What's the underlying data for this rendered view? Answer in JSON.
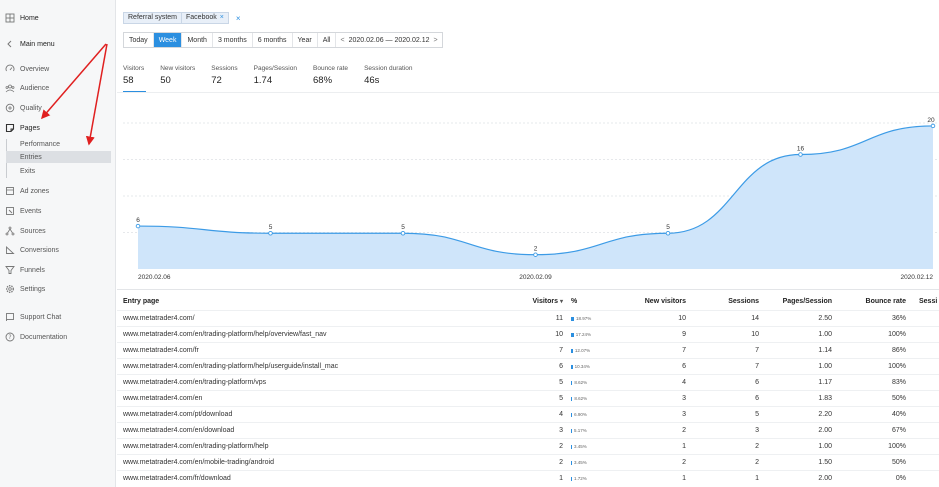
{
  "sidebar": {
    "items": [
      {
        "label": "Home",
        "icon": "home-icon"
      },
      {
        "label": "Main menu",
        "icon": "chevron-left-icon"
      },
      {
        "label": "Overview",
        "icon": "gauge-icon"
      },
      {
        "label": "Audience",
        "icon": "audience-icon"
      },
      {
        "label": "Quality",
        "icon": "quality-icon"
      },
      {
        "label": "Pages",
        "icon": "pages-icon"
      },
      {
        "label": "Ad zones",
        "icon": "ad-zones-icon"
      },
      {
        "label": "Events",
        "icon": "events-icon"
      },
      {
        "label": "Sources",
        "icon": "sources-icon"
      },
      {
        "label": "Conversions",
        "icon": "conversions-icon"
      },
      {
        "label": "Funnels",
        "icon": "funnel-icon"
      },
      {
        "label": "Settings",
        "icon": "gear-icon"
      },
      {
        "label": "Support Chat",
        "icon": "chat-icon"
      },
      {
        "label": "Documentation",
        "icon": "help-icon"
      }
    ],
    "pages_sub": [
      {
        "label": "Performance"
      },
      {
        "label": "Entries"
      },
      {
        "label": "Exits"
      }
    ]
  },
  "filter": {
    "chip_group": "Referral system",
    "chip_value": "Facebook",
    "chip_remove": "×",
    "clear": "×"
  },
  "period": {
    "buttons": [
      "Today",
      "Week",
      "Month",
      "3 months",
      "6 months",
      "Year",
      "All"
    ],
    "active": "Week",
    "prev": "<",
    "next": ">",
    "range": "2020.02.06 — 2020.02.12"
  },
  "metrics": [
    {
      "label": "Visitors",
      "value": "58"
    },
    {
      "label": "New visitors",
      "value": "50"
    },
    {
      "label": "Sessions",
      "value": "72"
    },
    {
      "label": "Pages/Session",
      "value": "1.74"
    },
    {
      "label": "Bounce rate",
      "value": "68%"
    },
    {
      "label": "Session duration",
      "value": "46s"
    }
  ],
  "chart_data": {
    "type": "area",
    "x": [
      "2020.02.06",
      "2020.02.07",
      "2020.02.08",
      "2020.02.09",
      "2020.02.10",
      "2020.02.11",
      "2020.02.12"
    ],
    "series": [
      {
        "values": [
          6,
          5,
          5,
          2,
          5,
          16,
          20
        ]
      }
    ],
    "x_tick_labels": [
      "2020.02.06",
      "2020.02.09",
      "2020.02.12"
    ],
    "data_labels": [
      "6",
      "5",
      "5",
      "2",
      "5",
      "16",
      "20"
    ],
    "ylim": [
      0,
      20
    ],
    "grid": "horizontal dashed",
    "line_color": "#3c9be6",
    "fill_color": "#cfe5fa"
  },
  "table": {
    "headers": {
      "page": "Entry page",
      "visitors": "Visitors",
      "sort": "▾",
      "pct": "%",
      "new": "New visitors",
      "sessions": "Sessions",
      "pps": "Pages/Session",
      "bounce": "Bounce rate",
      "sessd": "Sessi"
    },
    "rows": [
      {
        "page": "www.metatrader4.com/",
        "visitors": "11",
        "pct": "18.97%",
        "pct_val": 18.97,
        "new": "10",
        "sessions": "14",
        "pps": "2.50",
        "bounce": "36%"
      },
      {
        "page": "www.metatrader4.com/en/trading-platform/help/overview/fast_nav",
        "visitors": "10",
        "pct": "17.24%",
        "pct_val": 17.24,
        "new": "9",
        "sessions": "10",
        "pps": "1.00",
        "bounce": "100%"
      },
      {
        "page": "www.metatrader4.com/fr",
        "visitors": "7",
        "pct": "12.07%",
        "pct_val": 12.07,
        "new": "7",
        "sessions": "7",
        "pps": "1.14",
        "bounce": "86%"
      },
      {
        "page": "www.metatrader4.com/en/trading-platform/help/userguide/install_mac",
        "visitors": "6",
        "pct": "10.34%",
        "pct_val": 10.34,
        "new": "6",
        "sessions": "7",
        "pps": "1.00",
        "bounce": "100%"
      },
      {
        "page": "www.metatrader4.com/en/trading-platform/vps",
        "visitors": "5",
        "pct": "8.62%",
        "pct_val": 8.62,
        "new": "4",
        "sessions": "6",
        "pps": "1.17",
        "bounce": "83%"
      },
      {
        "page": "www.metatrader4.com/en",
        "visitors": "5",
        "pct": "8.62%",
        "pct_val": 8.62,
        "new": "3",
        "sessions": "6",
        "pps": "1.83",
        "bounce": "50%"
      },
      {
        "page": "www.metatrader4.com/pt/download",
        "visitors": "4",
        "pct": "6.90%",
        "pct_val": 6.9,
        "new": "3",
        "sessions": "5",
        "pps": "2.20",
        "bounce": "40%"
      },
      {
        "page": "www.metatrader4.com/en/download",
        "visitors": "3",
        "pct": "5.17%",
        "pct_val": 5.17,
        "new": "2",
        "sessions": "3",
        "pps": "2.00",
        "bounce": "67%"
      },
      {
        "page": "www.metatrader4.com/en/trading-platform/help",
        "visitors": "2",
        "pct": "3.45%",
        "pct_val": 3.45,
        "new": "1",
        "sessions": "2",
        "pps": "1.00",
        "bounce": "100%"
      },
      {
        "page": "www.metatrader4.com/en/mobile-trading/android",
        "visitors": "2",
        "pct": "3.45%",
        "pct_val": 3.45,
        "new": "2",
        "sessions": "2",
        "pps": "1.50",
        "bounce": "50%"
      },
      {
        "page": "www.metatrader4.com/fr/download",
        "visitors": "1",
        "pct": "1.72%",
        "pct_val": 1.72,
        "new": "1",
        "sessions": "1",
        "pps": "2.00",
        "bounce": "0%"
      }
    ]
  },
  "colors": {
    "accent": "#2b8fe0",
    "annotation_arrow": "#e02020"
  }
}
